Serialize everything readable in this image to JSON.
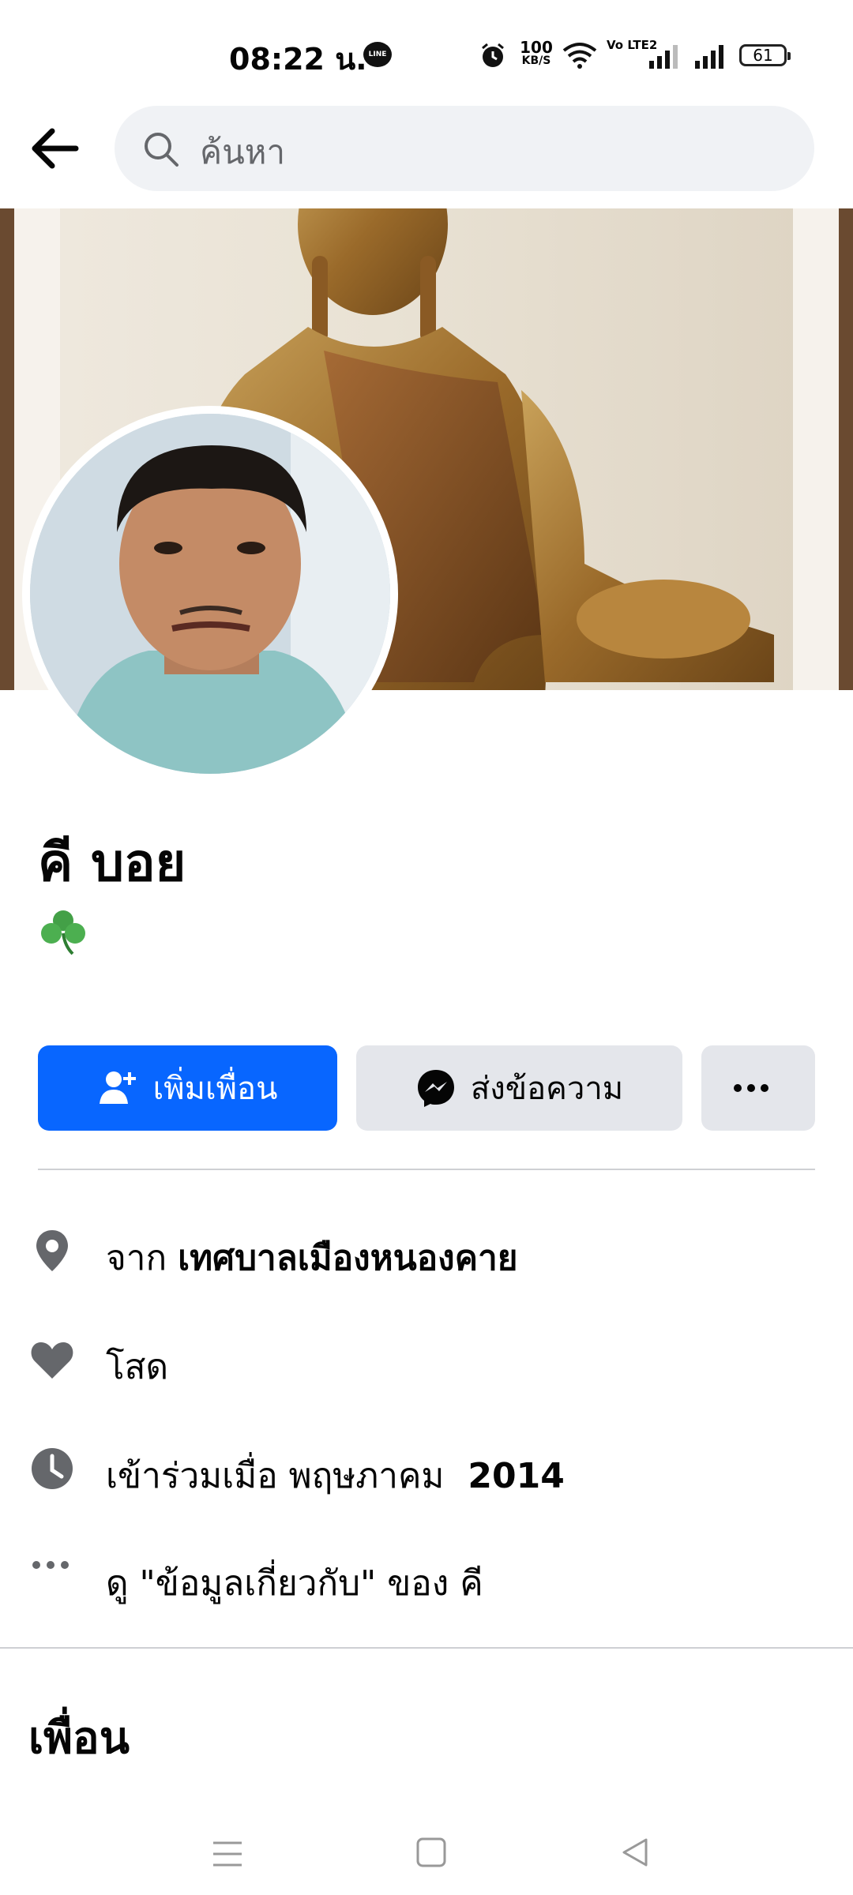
{
  "status_bar": {
    "time": "08:22 น.",
    "net_speed_value": "100",
    "net_speed_unit": "KB/S",
    "volte": "Vo LTE2",
    "battery": "61",
    "line_label": "LINE"
  },
  "search": {
    "placeholder": "ค้นหา"
  },
  "profile": {
    "name": "คี บอย",
    "bio_icon": "shamrock"
  },
  "actions": {
    "add_friend_label": "เพิ่มเพื่อน",
    "message_label": "ส่งข้อความ"
  },
  "info": {
    "from_prefix": "จาก",
    "from_place": "เทศบาลเมืองหนองคาย",
    "relationship": "โสด",
    "joined_prefix": "เข้าร่วมเมื่อ พฤษภาคม",
    "joined_year": "2014",
    "about_link": "ดู \"ข้อมูลเกี่ยวกับ\" ของ คี"
  },
  "friends": {
    "heading": "เพื่อน"
  },
  "colors": {
    "primary": "#0866ff",
    "secondary_button": "#e4e6eb",
    "icon_gray": "#65676b"
  }
}
